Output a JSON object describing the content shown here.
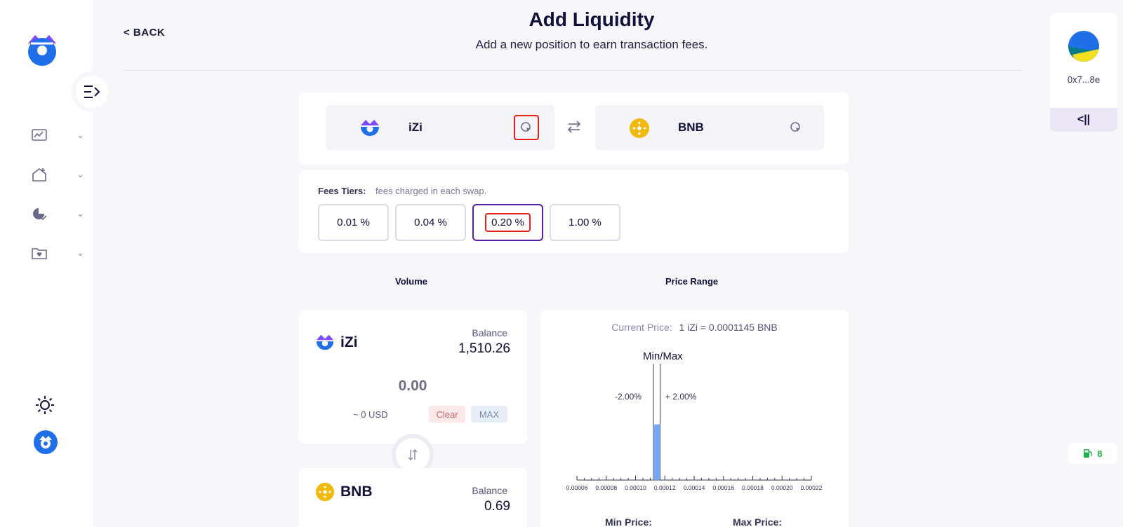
{
  "header": {
    "back_label": "< BACK",
    "title": "Add Liquidity",
    "subtitle": "Add a new position to earn transaction fees."
  },
  "sidebar": {
    "items": [
      {
        "icon": "chart-swap-icon"
      },
      {
        "icon": "home-add-icon"
      },
      {
        "icon": "pie-check-icon"
      },
      {
        "icon": "folder-heart-icon"
      }
    ]
  },
  "pair": {
    "token_a": "iZi",
    "token_b": "BNB"
  },
  "fees": {
    "label": "Fees Tiers:",
    "description": "fees charged in each swap.",
    "tiers": [
      "0.01 %",
      "0.04 %",
      "0.20 %",
      "1.00 %"
    ],
    "selected": "0.20 %"
  },
  "sections": {
    "volume": "Volume",
    "price_range": "Price Range"
  },
  "volume": {
    "token_a": {
      "name": "iZi",
      "balance_label": "Balance",
      "balance": "1,510.26",
      "amount": "0.00",
      "usd": "~ 0 USD",
      "clear_label": "Clear",
      "max_label": "MAX"
    },
    "token_b": {
      "name": "BNB",
      "balance_label": "Balance",
      "balance": "0.69"
    }
  },
  "price": {
    "current_label": "Current Price:",
    "current_value": "1 iZi = 0.0001145 BNB",
    "minmax_label": "Min/Max",
    "pct_minus": "-2.00%",
    "pct_plus": "+ 2.00%",
    "min_label": "Min Price:",
    "max_label": "Max Price:"
  },
  "chart_data": {
    "type": "bar",
    "x_ticks": [
      "0.00006",
      "0.00008",
      "0.00010",
      "0.00012",
      "0.00014",
      "0.00016",
      "0.00018",
      "0.00020",
      "0.00022"
    ],
    "xlim": [
      6e-05,
      0.00022
    ],
    "bars": [
      {
        "x": 0.0001145,
        "relative_height": 0.49
      }
    ],
    "range_min": 0.0001122,
    "range_max": 0.0001168,
    "bar_color": "#7aa7f2"
  },
  "wallet": {
    "address": "0x7...8e",
    "expand_label": "<||"
  },
  "gas": {
    "value": "8"
  },
  "colors": {
    "accent": "#5a1fa8",
    "brand_blue": "#1e6fe8",
    "highlight": "#e8201a"
  }
}
